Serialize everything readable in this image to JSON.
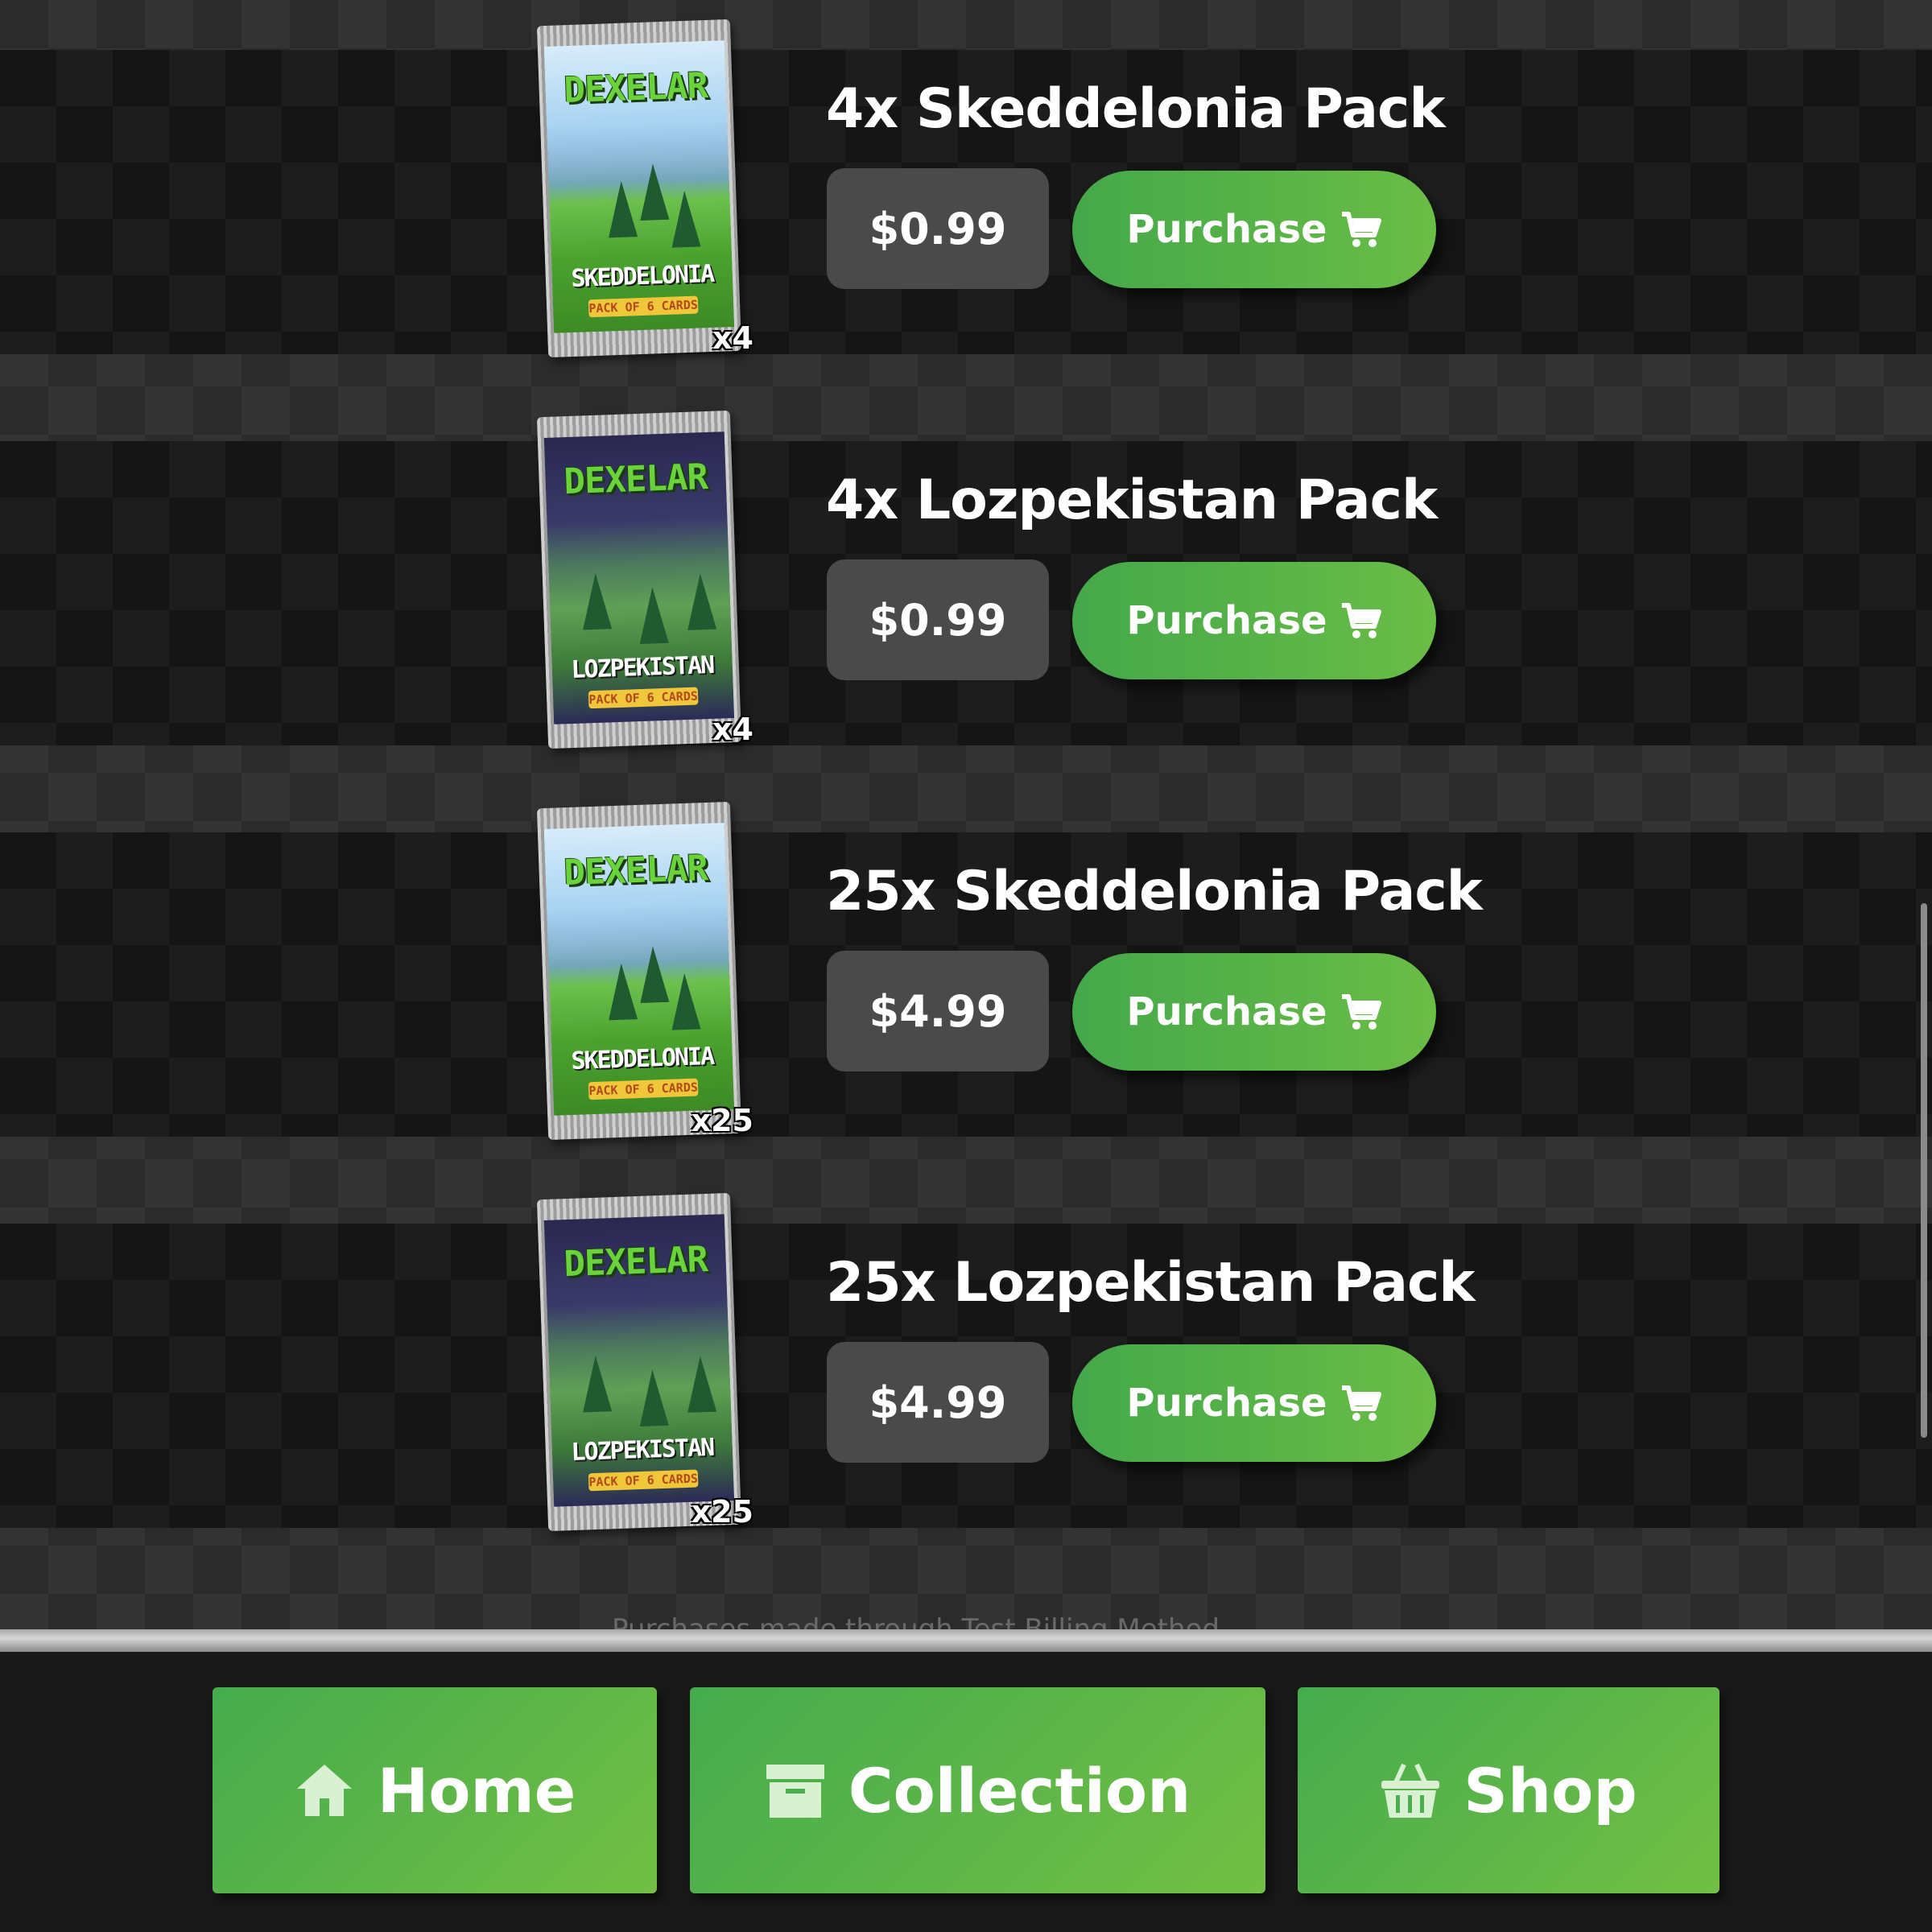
{
  "shop_items": [
    {
      "title": "4x Skeddelonia Pack",
      "price": "$0.99",
      "purchase_label": "Purchase",
      "pack": {
        "brand": "DEXELAR",
        "region": "SKEDDELONIA",
        "subtitle": "PACK OF 6 CARDS",
        "quantity": "x4",
        "theme": "day"
      }
    },
    {
      "title": "4x Lozpekistan Pack",
      "price": "$0.99",
      "purchase_label": "Purchase",
      "pack": {
        "brand": "DEXELAR",
        "region": "LOZPEKISTAN",
        "subtitle": "PACK OF 6 CARDS",
        "quantity": "x4",
        "theme": "night"
      }
    },
    {
      "title": "25x Skeddelonia Pack",
      "price": "$4.99",
      "purchase_label": "Purchase",
      "pack": {
        "brand": "DEXELAR",
        "region": "SKEDDELONIA",
        "subtitle": "PACK OF 6 CARDS",
        "quantity": "x25",
        "theme": "day"
      }
    },
    {
      "title": "25x Lozpekistan Pack",
      "price": "$4.99",
      "purchase_label": "Purchase",
      "pack": {
        "brand": "DEXELAR",
        "region": "LOZPEKISTAN",
        "subtitle": "PACK OF 6 CARDS",
        "quantity": "x25",
        "theme": "night"
      }
    }
  ],
  "footer_note": "Purchases made through Test Billing Method",
  "nav": {
    "home": {
      "label": "Home",
      "icon": "home-icon"
    },
    "collection": {
      "label": "Collection",
      "icon": "archive-box-icon"
    },
    "shop": {
      "label": "Shop",
      "icon": "basket-icon"
    }
  },
  "colors": {
    "accent_green": "#4caf50",
    "price_bg": "#4a4a4a",
    "row_bg": "#151515",
    "nav_bg": "#191919"
  }
}
